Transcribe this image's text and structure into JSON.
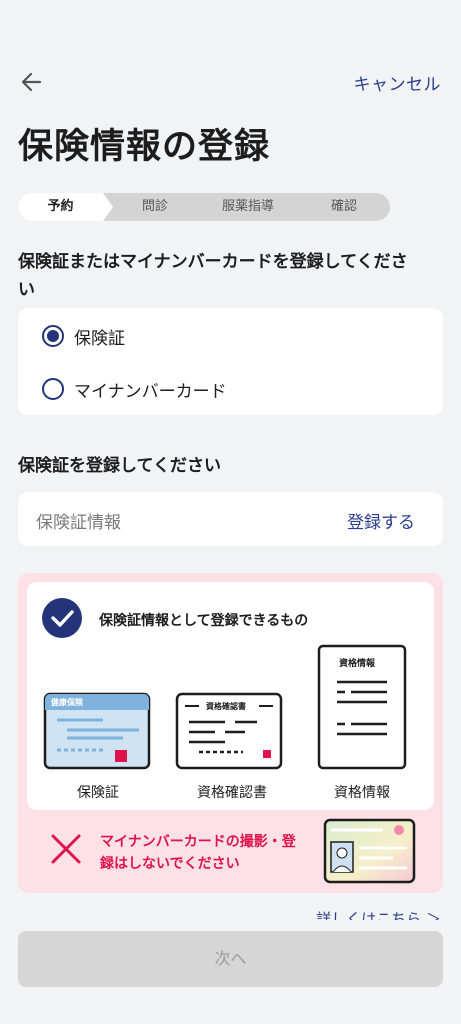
{
  "header": {
    "cancel_label": "キャンセル",
    "back_icon": "arrow-left-icon"
  },
  "page": {
    "title": "保険情報の登録"
  },
  "stepper": {
    "steps": [
      "予約",
      "問診",
      "服薬指導",
      "確認"
    ],
    "active_index": 0
  },
  "card_type": {
    "question_line1": "保険証またはマイナンバーカードを登録してくださ",
    "question_line2": "い",
    "options": [
      {
        "label": "保険証",
        "selected": true
      },
      {
        "label": "マイナンバーカード",
        "selected": false
      }
    ]
  },
  "insurance": {
    "heading": "保険証を登録してください",
    "field_placeholder": "保険証情報",
    "register_label": "登録する"
  },
  "accepted_docs": {
    "title": "保険証情報として登録できるもの",
    "docs": [
      {
        "caption": "保険証",
        "card_label": "健康保険"
      },
      {
        "caption": "資格確認書",
        "card_label": "資格確認書"
      },
      {
        "caption": "資格情報",
        "card_label": "資格情報"
      }
    ]
  },
  "warning": {
    "text": "マイナンバーカードの撮影・登録はしないでください"
  },
  "details_link": "詳しくはこちら ＞",
  "next_button": "次へ",
  "colors": {
    "accent": "#24337a",
    "link": "#2a3d8f",
    "warning": "#e0144c",
    "warning_bg": "#fde1e6"
  }
}
